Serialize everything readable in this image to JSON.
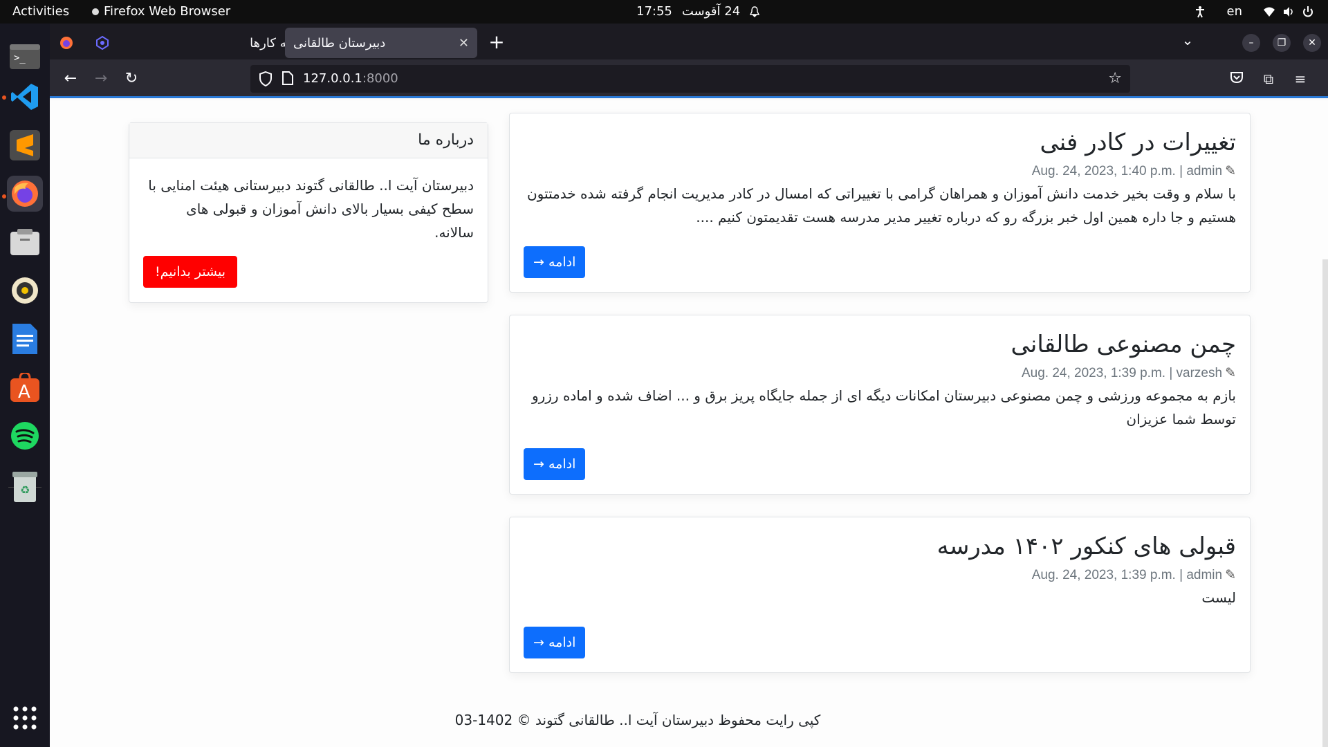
{
  "topbar": {
    "activities": "Activities",
    "app_name": "Firefox Web Browser",
    "clock_time": "17:55",
    "clock_date": "24 آقوست",
    "language": "en"
  },
  "dock": {
    "items": [
      "terminal-icon",
      "vscode-icon",
      "sublime-icon",
      "firefox-icon",
      "files-icon",
      "rhythmbox-icon",
      "writer-icon",
      "appstore-icon",
      "spotify-icon",
      "trash-icon",
      "app-grid-icon"
    ]
  },
  "browser": {
    "tabs": [
      {
        "title": "نمونه کارها",
        "active": false
      },
      {
        "title": "دبیرستان طالقانی",
        "active": true
      }
    ],
    "url_host": "127.0.0.1",
    "url_port": ":8000"
  },
  "page": {
    "posts": [
      {
        "title": "تغییرات در کادر فنی",
        "meta": "Aug. 24, 2023, 1:40 p.m. | admin",
        "excerpt": "با سلام و وقت بخیر خدمت دانش آموزان و همراهان گرامی با تغییراتی که امسال در کادر مدیریت انجام گرفته شده خدمتتون هستیم و جا داره همین اول خبر بزرگه رو که درباره تغییر مدیر مدرسه هست تقدیمتون کنیم ....",
        "button": "ادامه →"
      },
      {
        "title": "چمن مصنوعی طالقانی",
        "meta": "Aug. 24, 2023, 1:39 p.m. | varzesh",
        "excerpt": "بازم به مجموعه ورزشی و چمن مصنوعی دبیرستان امکانات دیگه ای از جمله جایگاه پریز برق و ... اضاف شده و اماده رزرو توسط شما عزیزان",
        "button": "ادامه →"
      },
      {
        "title": "قبولی های کنکور ۱۴۰۲ مدرسه",
        "meta": "Aug. 24, 2023, 1:39 p.m. | admin",
        "excerpt": "لیست",
        "button": "ادامه →"
      }
    ],
    "about": {
      "header": "درباره ما",
      "body": "دبیرستان آیت ا.. طالقانی گتوند دبیرستانی هیئت امنایی با سطح کیفی بسیار بالای دانش آموزان و قبولی های سالانه.",
      "button": "بیشتر بدانیم!"
    },
    "footer": "کپی رایت محفوظ دبیرستان آیت ا.. طالقانی گتوند © 1402-03"
  },
  "colors": {
    "primary_button": "#0d6efd",
    "red_button": "#ff0000",
    "firefox_tab_bg": "#1c1b22",
    "firefox_toolbar": "#2b2a33"
  }
}
